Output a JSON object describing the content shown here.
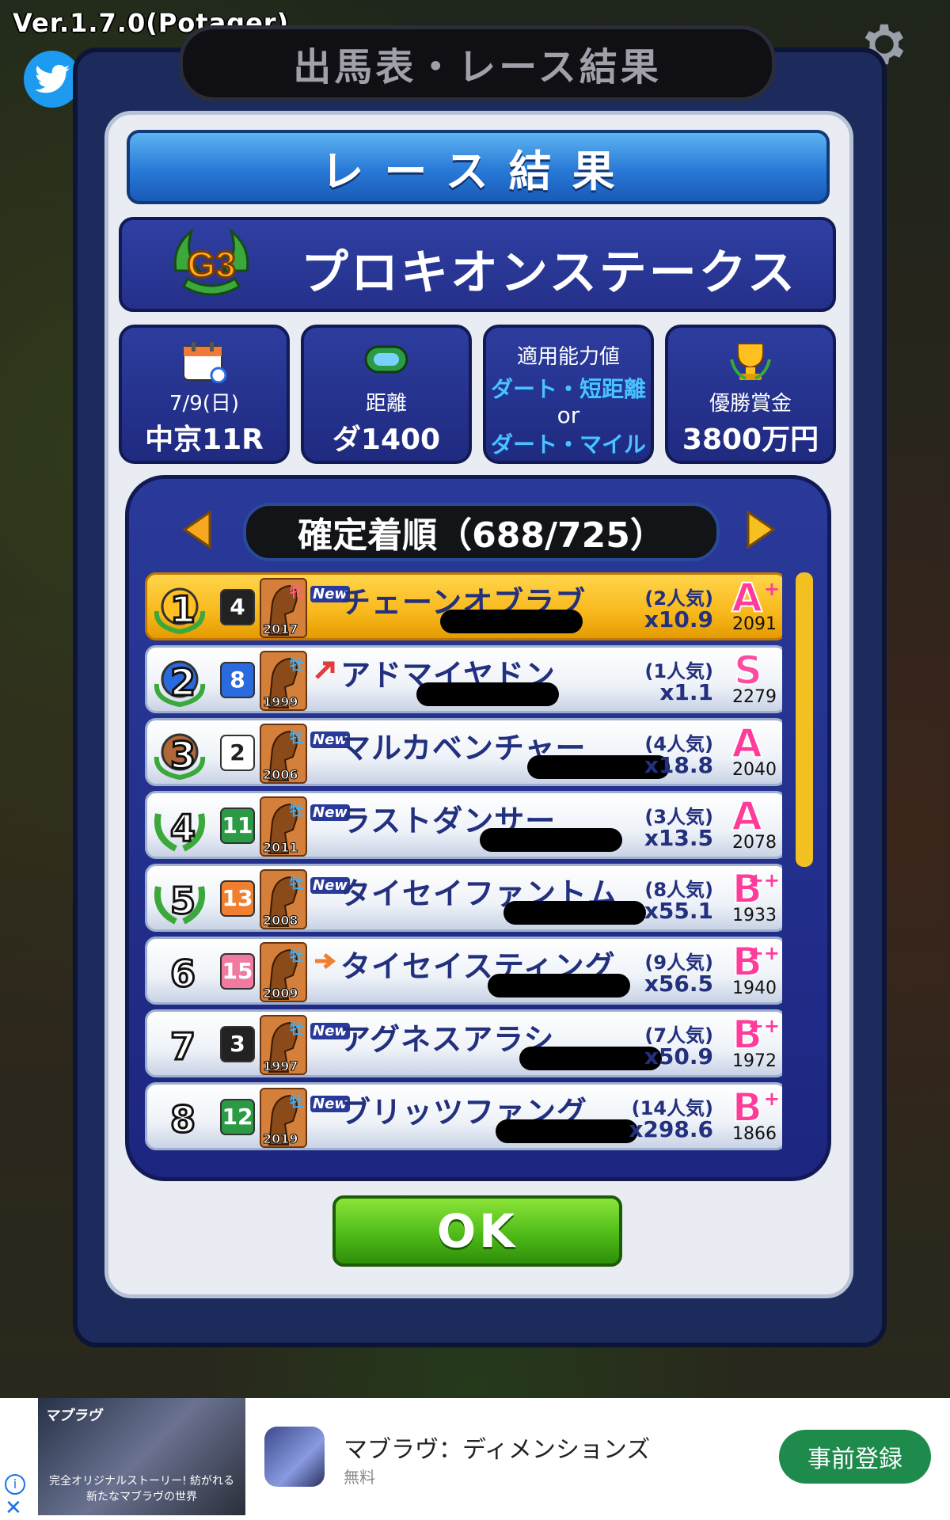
{
  "version": "Ver.1.7.0(Potager)",
  "panel_title": "出馬表・レース結果",
  "banner": "レース結果",
  "race": {
    "grade": "G3",
    "name": "プロキオンステークス"
  },
  "info": {
    "date": "7/9(日)",
    "venue": "中京11R",
    "distance_label": "距離",
    "distance": "ダ1400",
    "ability_label": "適用能力値",
    "ability_1": "ダート・短距離",
    "ability_or": "or",
    "ability_2": "ダート・マイル",
    "prize_label": "優勝賞金",
    "prize": "3800万円"
  },
  "order_title": "確定着順（688/725）",
  "rows": [
    {
      "place": "1",
      "gate": "4",
      "year": "2017",
      "sex": "牝",
      "tag": "New",
      "name": "チェーンオブラブ",
      "pop": "(2人気)",
      "odds": "x10.9",
      "grade": "A",
      "plus": "+",
      "rating": "2091"
    },
    {
      "place": "2",
      "gate": "8",
      "year": "1999",
      "sex": "牡",
      "tag": "",
      "name": "アドマイヤドン",
      "pop": "(1人気)",
      "odds": "x1.1",
      "grade": "S",
      "plus": "",
      "rating": "2279"
    },
    {
      "place": "3",
      "gate": "2",
      "year": "2006",
      "sex": "牡",
      "tag": "New",
      "name": "マルカベンチャー",
      "pop": "(4人気)",
      "odds": "x18.8",
      "grade": "A",
      "plus": "",
      "rating": "2040"
    },
    {
      "place": "4",
      "gate": "11",
      "year": "2011",
      "sex": "牡",
      "tag": "New",
      "name": "ラストダンサー",
      "pop": "(3人気)",
      "odds": "x13.5",
      "grade": "A",
      "plus": "",
      "rating": "2078"
    },
    {
      "place": "5",
      "gate": "13",
      "year": "2008",
      "sex": "牡",
      "tag": "New",
      "name": "タイセイファントム",
      "pop": "(8人気)",
      "odds": "x55.1",
      "grade": "B",
      "plus": "++",
      "rating": "1933"
    },
    {
      "place": "6",
      "gate": "15",
      "year": "2009",
      "sex": "牡",
      "tag": "",
      "name": "タイセイスティング",
      "pop": "(9人気)",
      "odds": "x56.5",
      "grade": "B",
      "plus": "++",
      "rating": "1940"
    },
    {
      "place": "7",
      "gate": "3",
      "year": "1997",
      "sex": "牡",
      "tag": "New",
      "name": "アグネスアラシ",
      "pop": "(7人気)",
      "odds": "x50.9",
      "grade": "B",
      "plus": "++",
      "rating": "1972"
    },
    {
      "place": "8",
      "gate": "12",
      "year": "2019",
      "sex": "牡",
      "tag": "New",
      "name": "ブリッツファング",
      "pop": "(14人気)",
      "odds": "x298.6",
      "grade": "B",
      "plus": "+",
      "rating": "1866"
    }
  ],
  "ok_label": "OK",
  "ad": {
    "title": "マブラヴ：ディメンションズ",
    "sub": "無料",
    "button": "事前登録",
    "logo": "マブラヴ",
    "caption": "完全オリジナルストーリー! 紡がれる新たなマブラヴの世界"
  },
  "colors": {
    "gate": [
      "#ffffff",
      "#222222",
      "#e23b3b",
      "#2a6adf",
      "#e8c020",
      "#2a9a44",
      "#f08030",
      "#f07aa0"
    ]
  }
}
